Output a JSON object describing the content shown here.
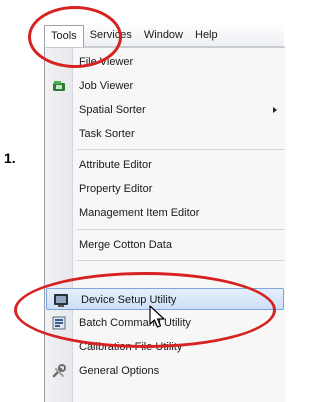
{
  "step_label": "1.",
  "menubar": {
    "items": [
      "Tools",
      "Services",
      "Window",
      "Help"
    ]
  },
  "menu": {
    "items": [
      {
        "label": "File Viewer",
        "icon": "none"
      },
      {
        "label": "Job Viewer",
        "icon": "job-viewer-icon"
      },
      {
        "label": "Spatial Sorter",
        "icon": "none",
        "submenu": true
      },
      {
        "label": "Task Sorter",
        "icon": "none"
      },
      {
        "label": "Attribute Editor",
        "icon": "none"
      },
      {
        "label": "Property Editor",
        "icon": "none"
      },
      {
        "label": "Management Item Editor",
        "icon": "none"
      },
      {
        "label": "Merge Cotton Data",
        "icon": "none"
      },
      {
        "label": "Device Setup Utility",
        "icon": "device-setup-icon",
        "highlighted": true
      },
      {
        "label": "Batch Command Utility",
        "icon": "batch-command-icon"
      },
      {
        "label": "Calibration File Utility",
        "icon": "none"
      },
      {
        "label": "General Options",
        "icon": "tools-icon"
      }
    ]
  },
  "colors": {
    "annotation_red": "#d72222",
    "highlight_border": "#7ea6dc",
    "highlight_fill": "#cddff7"
  }
}
